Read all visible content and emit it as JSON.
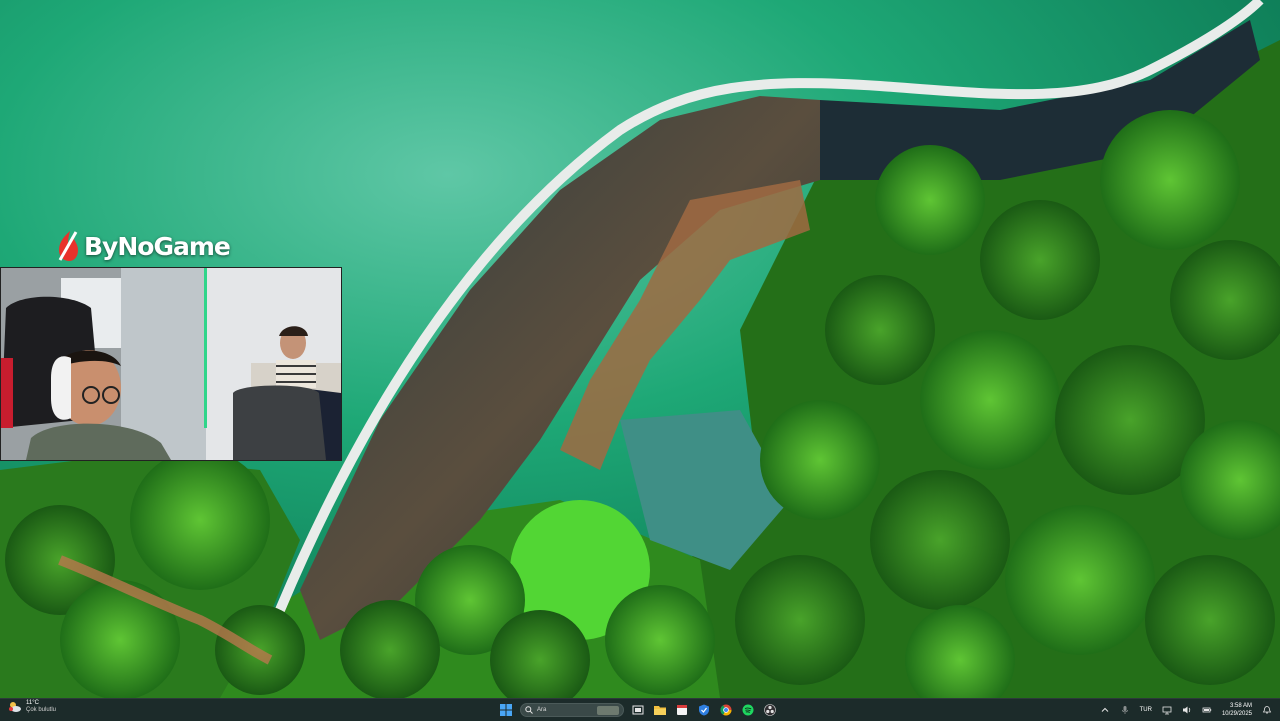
{
  "sponsor": {
    "name": "ByNoGame"
  },
  "taskbar": {
    "weather": {
      "temperature": "11°C",
      "condition": "Çok bulutlu",
      "icon": "cloud-sun-icon"
    },
    "search": {
      "placeholder": "Ara"
    },
    "pinned_apps": [
      {
        "name": "start-button",
        "icon": "windows-logo-icon"
      },
      {
        "name": "task-view",
        "icon": "task-view-icon"
      },
      {
        "name": "file-explorer",
        "icon": "folder-icon"
      },
      {
        "name": "calendar",
        "icon": "calendar-icon"
      },
      {
        "name": "vpn",
        "icon": "shield-icon"
      },
      {
        "name": "chrome",
        "icon": "chrome-icon"
      },
      {
        "name": "spotify",
        "icon": "spotify-icon"
      },
      {
        "name": "obs",
        "icon": "obs-icon"
      }
    ],
    "tray": {
      "language": "TUR",
      "time": "3:58 AM",
      "date": "10/29/2025"
    }
  },
  "colors": {
    "water": "#1fa572",
    "forest": "#2f8a1e",
    "taskbar": "#1c2b2a"
  }
}
